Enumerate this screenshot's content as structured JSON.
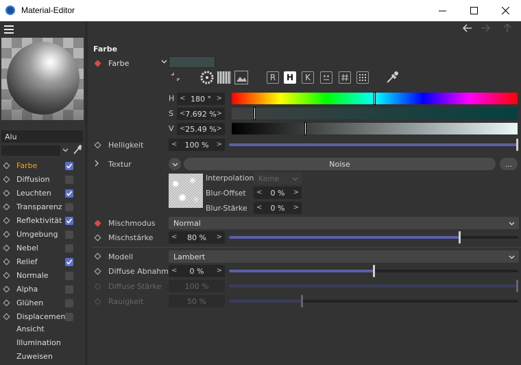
{
  "window": {
    "title": "Material-Editor"
  },
  "nav": {
    "back": "back-arrow",
    "forward": "forward-arrow",
    "up": "up-arrow"
  },
  "material": {
    "name": "Alu",
    "search_placeholder": ""
  },
  "channels": [
    {
      "label": "Farbe",
      "checked": true,
      "active": true
    },
    {
      "label": "Diffusion",
      "checked": false
    },
    {
      "label": "Leuchten",
      "checked": true
    },
    {
      "label": "Transparenz",
      "checked": false
    },
    {
      "label": "Reflektivität",
      "checked": true
    },
    {
      "label": "Umgebung",
      "checked": false
    },
    {
      "label": "Nebel",
      "checked": false
    },
    {
      "label": "Relief",
      "checked": true
    },
    {
      "label": "Normale",
      "checked": false
    },
    {
      "label": "Alpha",
      "checked": false
    },
    {
      "label": "Glühen",
      "checked": false
    },
    {
      "label": "Displacement",
      "checked": false
    }
  ],
  "extra_items": [
    "Ansicht",
    "Illumination",
    "Zuweisen"
  ],
  "section": {
    "title": "Farbe"
  },
  "color": {
    "label": "Farbe",
    "mode_buttons": [
      "R",
      "H",
      "K"
    ],
    "active_mode": "H",
    "h": {
      "label": "H",
      "value": "180 °",
      "fraction": 0.5
    },
    "s": {
      "label": "S",
      "value": "7.692 %",
      "fraction": 0.077
    },
    "v": {
      "label": "V",
      "value": "25.49 %",
      "fraction": 0.255
    },
    "swatch": "#3c4a4a"
  },
  "helligkeit": {
    "label": "Helligkeit",
    "value": "100 %",
    "fraction": 1.0
  },
  "textur": {
    "label": "Textur",
    "value": "Noise",
    "more": "...",
    "interpolation_label": "Interpolation",
    "interpolation_value": "Keine",
    "blur_offset_label": "Blur-Offset",
    "blur_offset_value": "0 %",
    "blur_staerke_label": "Blur-Stärke",
    "blur_staerke_value": "0 %"
  },
  "mischmodus": {
    "label": "Mischmodus",
    "value": "Normal"
  },
  "mischstaerke": {
    "label": "Mischstärke",
    "value": "80 %",
    "fraction": 0.8
  },
  "modell": {
    "label": "Modell",
    "value": "Lambert"
  },
  "diffuse_abnahme": {
    "label": "Diffuse Abnahme",
    "value": "0 %",
    "fraction": 0.5
  },
  "diffuse_staerke": {
    "label": "Diffuse Stärke",
    "value": "100 %",
    "fraction": 1.0
  },
  "rauigkeit": {
    "label": "Rauigkeit",
    "value": "50 %",
    "fraction": 0.25
  },
  "colors": {
    "accent": "#5b60a8",
    "checkbox_on": "#5a70c8",
    "active_label": "#f0a030",
    "marker": "#d94a4a"
  }
}
